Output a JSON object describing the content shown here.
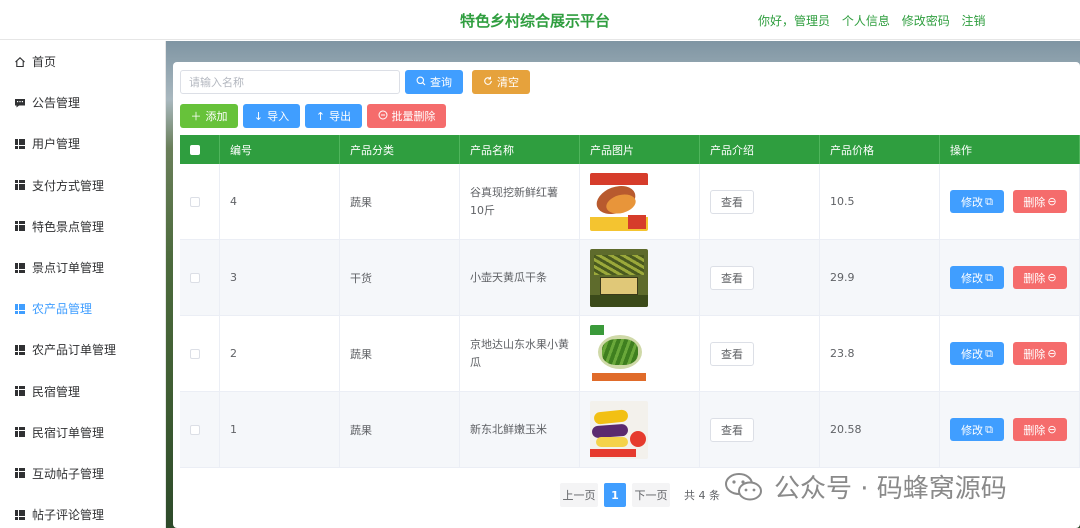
{
  "header": {
    "title": "特色乡村综合展示平台",
    "greeting": "你好，管理员",
    "profile_link": "个人信息",
    "password_link": "修改密码",
    "logout_link": "注销"
  },
  "sidebar": {
    "items": [
      {
        "label": "首页",
        "icon": "home-icon"
      },
      {
        "label": "公告管理",
        "icon": "message-icon"
      },
      {
        "label": "用户管理",
        "icon": "grid-icon"
      },
      {
        "label": "支付方式管理",
        "icon": "grid-icon"
      },
      {
        "label": "特色景点管理",
        "icon": "grid-icon"
      },
      {
        "label": "景点订单管理",
        "icon": "grid-icon"
      },
      {
        "label": "农产品管理",
        "icon": "grid-icon",
        "active": true
      },
      {
        "label": "农产品订单管理",
        "icon": "grid-icon"
      },
      {
        "label": "民宿管理",
        "icon": "grid-icon"
      },
      {
        "label": "民宿订单管理",
        "icon": "grid-icon"
      },
      {
        "label": "互动帖子管理",
        "icon": "grid-icon"
      },
      {
        "label": "帖子评论管理",
        "icon": "grid-icon"
      }
    ]
  },
  "toolbar": {
    "search_placeholder": "请输入名称",
    "search_value": "",
    "query_label": "查询",
    "clear_label": "清空",
    "add_label": "添加",
    "import_label": "导入",
    "export_label": "导出",
    "batch_delete_label": "批量删除"
  },
  "table": {
    "columns": [
      "编号",
      "产品分类",
      "产品名称",
      "产品图片",
      "产品介绍",
      "产品价格",
      "操作"
    ],
    "view_label": "查看",
    "edit_label": "修改",
    "delete_label": "删除",
    "rows": [
      {
        "id": "4",
        "category": "蔬果",
        "name": "谷真现挖新鲜红薯10斤",
        "price": "10.5",
        "image": "sweet-potato"
      },
      {
        "id": "3",
        "category": "干货",
        "name": "小壶天黄瓜干条",
        "price": "29.9",
        "image": "dried-cucumber"
      },
      {
        "id": "2",
        "category": "蔬果",
        "name": "京地达山东水果小黄瓜",
        "price": "23.8",
        "image": "cucumber"
      },
      {
        "id": "1",
        "category": "蔬果",
        "name": "新东北鲜嫩玉米",
        "price": "20.58",
        "image": "corn"
      }
    ]
  },
  "pagination": {
    "prev_label": "上一页",
    "current_page": "1",
    "next_label": "下一页",
    "total_label": "共 4 条"
  },
  "watermark": {
    "text": "公众号 · 码蜂窝源码"
  },
  "colors": {
    "primary_green": "#2f9e3f",
    "blue": "#409eff",
    "orange": "#e6a23c",
    "light_green": "#67c23a",
    "red": "#f56c6c"
  }
}
